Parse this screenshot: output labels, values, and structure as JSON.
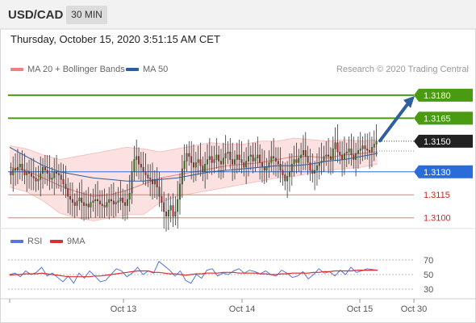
{
  "header": {
    "symbol": "USD/CAD",
    "timeframe": "30 MIN"
  },
  "datetime": "Thursday, October 15, 2020 3:51:15 AM CET",
  "legend": {
    "ma20": {
      "label": "MA 20 + Bollinger Bands",
      "color": "#f08080"
    },
    "ma50": {
      "label": "MA 50",
      "color": "#2c5d9e"
    },
    "rsi": {
      "label": "RSI",
      "color": "#5577dd"
    },
    "ma9": {
      "label": "9MA",
      "color": "#d63030"
    }
  },
  "credit": "Research © 2020 Trading Central",
  "chart_data": {
    "type": "candlestick",
    "instrument": "USD/CAD",
    "interval": "30 MIN",
    "ylim": [
      1.3093,
      1.3191
    ],
    "levels": [
      {
        "price": "1.3180",
        "kind": "target",
        "color": "#4a9a12"
      },
      {
        "price": "1.3165",
        "kind": "target",
        "color": "#4a9a12"
      },
      {
        "price": "1.3150",
        "kind": "last",
        "color": "#222222"
      },
      {
        "price": "1.3130",
        "kind": "pivot",
        "color": "#2a6dd9"
      },
      {
        "price": "1.3115",
        "kind": "support",
        "color": "#e07a7a"
      },
      {
        "price": "1.3100",
        "kind": "support",
        "color": "#e07a7a"
      }
    ],
    "x_ticks": [
      "Oct 13",
      "Oct 14",
      "Oct 15",
      "Oct 30"
    ],
    "closes": [
      1.3128,
      1.3132,
      1.3131,
      1.3133,
      1.3135,
      1.3131,
      1.3128,
      1.313,
      1.3129,
      1.3127,
      1.3126,
      1.3124,
      1.3125,
      1.3129,
      1.3133,
      1.3131,
      1.3129,
      1.3125,
      1.3126,
      1.313,
      1.3129,
      1.3128,
      1.3125,
      1.3122,
      1.3119,
      1.3114,
      1.3112,
      1.311,
      1.3108,
      1.3111,
      1.3113,
      1.311,
      1.3108,
      1.3109,
      1.3107,
      1.311,
      1.3111,
      1.3112,
      1.3111,
      1.3109,
      1.3108,
      1.3107,
      1.311,
      1.3112,
      1.3111,
      1.3109,
      1.311,
      1.3111,
      1.3113,
      1.311,
      1.3108,
      1.3112,
      1.3116,
      1.313,
      1.3138,
      1.314,
      1.3135,
      1.3133,
      1.313,
      1.3128,
      1.3126,
      1.3125,
      1.3122,
      1.3125,
      1.312,
      1.3114,
      1.311,
      1.3104,
      1.3101,
      1.3105,
      1.3108,
      1.3101,
      1.3104,
      1.3112,
      1.3122,
      1.3132,
      1.3137,
      1.3142,
      1.314,
      1.3136,
      1.3133,
      1.3136,
      1.3138,
      1.3134,
      1.313,
      1.3135,
      1.3138,
      1.314,
      1.3136,
      1.3138,
      1.3141,
      1.3137,
      1.3135,
      1.3139,
      1.3142,
      1.3143,
      1.3138,
      1.3135,
      1.3138,
      1.3141,
      1.3138,
      1.3136,
      1.3133,
      1.3137,
      1.314,
      1.3141,
      1.3137,
      1.3139,
      1.3141,
      1.3136,
      1.3133,
      1.3131,
      1.3133,
      1.3136,
      1.314,
      1.3139,
      1.3137,
      1.3135,
      1.3131,
      1.3128,
      1.3124,
      1.3127,
      1.313,
      1.3135,
      1.3138,
      1.3136,
      1.3139,
      1.3141,
      1.3144,
      1.314,
      1.3136,
      1.3131,
      1.3129,
      1.3131,
      1.3134,
      1.3136,
      1.3137,
      1.314,
      1.3141,
      1.314,
      1.3138,
      1.3145,
      1.3149,
      1.3143,
      1.3141,
      1.3138,
      1.3142,
      1.3143,
      1.3145,
      1.3141,
      1.3138,
      1.3142,
      1.3144,
      1.3145,
      1.3147,
      1.3145,
      1.3144,
      1.3143,
      1.3146,
      1.3148,
      1.315
    ],
    "ma20_mid": [
      1.3133,
      1.3131,
      1.3126,
      1.3121,
      1.3117,
      1.3114,
      1.3115,
      1.3118,
      1.3122,
      1.3126,
      1.3128,
      1.313,
      1.3132,
      1.3134,
      1.3135,
      1.3136,
      1.3138,
      1.314,
      1.314,
      1.3139,
      1.3141,
      1.3142,
      1.3143
    ],
    "ma20_upper": [
      1.3147,
      1.3145,
      1.3141,
      1.3138,
      1.314,
      1.3142,
      1.3144,
      1.3146,
      1.3145,
      1.3143,
      1.3145,
      1.3147,
      1.3149,
      1.3148,
      1.3148,
      1.315,
      1.315,
      1.3152,
      1.3151,
      1.315,
      1.3151,
      1.315,
      1.3151
    ],
    "ma20_lower": [
      1.312,
      1.3117,
      1.3111,
      1.3103,
      1.31,
      1.3098,
      1.31,
      1.3102,
      1.3102,
      1.311,
      1.3114,
      1.3116,
      1.3118,
      1.312,
      1.3122,
      1.3124,
      1.3126,
      1.3127,
      1.3129,
      1.3131,
      1.3132,
      1.3133,
      1.3135
    ],
    "ma50": [
      1.3146,
      1.314,
      1.3134,
      1.313,
      1.3128,
      1.3126,
      1.3125,
      1.3124,
      1.3124,
      1.3125,
      1.3126,
      1.3128,
      1.313,
      1.3131,
      1.3132,
      1.3133,
      1.3134,
      1.3134,
      1.3135,
      1.3137,
      1.3138,
      1.314,
      1.3142
    ],
    "projection": {
      "from": 1.315,
      "to": 1.318
    },
    "rsi": {
      "ylim": [
        20,
        80
      ],
      "ticks": [
        "70",
        "50",
        "30"
      ],
      "rsi_values": [
        50,
        52,
        47,
        55,
        50,
        53,
        60,
        48,
        52,
        46,
        40,
        48,
        38,
        52,
        45,
        55,
        48,
        40,
        42,
        50,
        58,
        55,
        47,
        52,
        60,
        50,
        55,
        52,
        68,
        62,
        56,
        48,
        55,
        42,
        38,
        50,
        45,
        56,
        58,
        48,
        52,
        50,
        55,
        58,
        52,
        56,
        54,
        51,
        55,
        50,
        48,
        56,
        52,
        46,
        48,
        54,
        44,
        50,
        58,
        52,
        54,
        48,
        56,
        50,
        60,
        53,
        55,
        58,
        57,
        56
      ],
      "ma9_values": [
        49,
        50,
        50,
        51,
        51,
        51,
        52,
        51,
        50,
        49,
        48,
        47,
        47,
        47,
        47,
        47,
        48,
        48,
        49,
        50,
        51,
        52,
        53,
        54,
        55,
        55,
        55,
        53,
        53,
        52,
        51,
        51,
        50,
        49,
        50,
        51,
        51,
        52,
        52,
        52,
        53,
        53,
        53,
        52,
        52,
        52,
        52,
        51,
        51,
        50,
        50,
        51,
        51,
        52,
        52,
        52,
        52,
        53,
        53,
        54,
        54,
        55,
        55,
        55,
        55,
        56,
        56,
        56,
        56,
        56
      ]
    }
  }
}
